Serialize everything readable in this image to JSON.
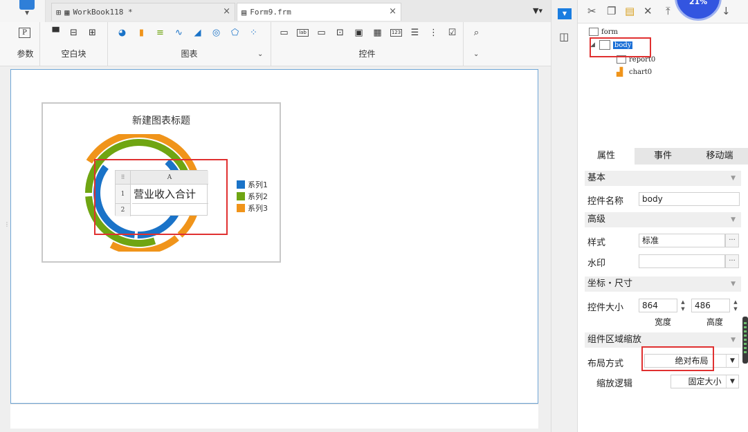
{
  "tabs": [
    {
      "label": "WorkBook118 *",
      "close": "×"
    },
    {
      "label": "Form9.frm",
      "close": "×"
    }
  ],
  "ribbon": {
    "groups": [
      {
        "label": "参数"
      },
      {
        "label": "空白块"
      },
      {
        "label": "图表"
      },
      {
        "label": "控件"
      }
    ],
    "param_icon": "P",
    "dropdown_chevron": "⌄"
  },
  "chart": {
    "title": "新建图表标题",
    "legend": [
      {
        "name": "系列1",
        "color": "#1a73c8"
      },
      {
        "name": "系列2",
        "color": "#6fa512"
      },
      {
        "name": "系列3",
        "color": "#f0941a"
      }
    ]
  },
  "chart_data": {
    "type": "pie",
    "title": "新建图表标题",
    "series": [
      {
        "name": "系列1",
        "values": [
          40,
          35,
          25
        ]
      },
      {
        "name": "系列2",
        "values": [
          30,
          45,
          25
        ]
      },
      {
        "name": "系列3",
        "values": [
          55,
          20,
          25
        ]
      }
    ],
    "legend_placement": "right"
  },
  "report": {
    "col_header": "A",
    "row1": "1",
    "row2": "2",
    "cell_a1": "营业收入合计"
  },
  "tree": {
    "root": "form",
    "body": "body",
    "report": "report0",
    "chart": "chart0"
  },
  "progress": {
    "value": "21%"
  },
  "prop_tabs": [
    "属性",
    "事件",
    "移动端"
  ],
  "sections": {
    "basic": "基本",
    "advanced": "高级",
    "coords": "坐标・尺寸",
    "zoom": "组件区域缩放"
  },
  "props": {
    "name_label": "控件名称",
    "name_value": "body",
    "style_label": "样式",
    "style_value": "标准",
    "watermark_label": "水印",
    "watermark_value": "",
    "size_label": "控件大小",
    "width_value": "864",
    "height_value": "486",
    "width_label": "宽度",
    "height_label": "高度",
    "layout_label": "布局方式",
    "layout_value": "绝对布局",
    "zoom_logic_label": "缩放逻辑",
    "zoom_logic_value": "固定大小"
  }
}
